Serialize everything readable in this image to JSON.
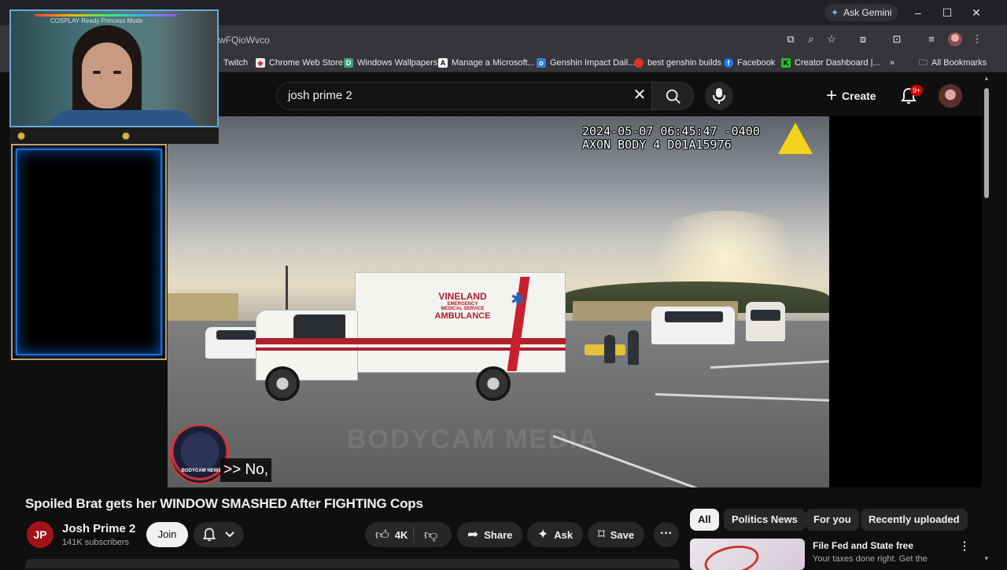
{
  "browser": {
    "gemini_label": "Ask Gemini",
    "url_fragment": "wFQioWvco",
    "bookmarks": [
      {
        "label": "Twitch"
      },
      {
        "label": "Chrome Web Store"
      },
      {
        "label": "Windows Wallpapers"
      },
      {
        "label": "Manage a Microsoft..."
      },
      {
        "label": "Genshin Impact Dail..."
      },
      {
        "label": "best genshin builds"
      },
      {
        "label": "Facebook"
      },
      {
        "label": "Creator Dashboard |..."
      }
    ],
    "bookmarks_overflow": "»",
    "all_bookmarks": "All Bookmarks",
    "window_controls": {
      "minimize": "–",
      "maximize": "☐",
      "close": "✕"
    }
  },
  "youtube_header": {
    "search_query": "josh prime 2",
    "create_label": "Create",
    "notification_badge": "9+"
  },
  "video": {
    "cam_timestamp": "2024-05-07 06:45:47 -0400",
    "cam_device": "AXON BODY 4 D01A15976",
    "caption": ">> No,",
    "ambulance_text": {
      "line1": "VINELAND",
      "line2": "EMERGENCY",
      "line3": "MEDICAL SERVICE",
      "line4": "AMBULANCE"
    },
    "watermark": "BODYCAM MEDIA",
    "badge_text": "BODYCAM NEWS"
  },
  "video_info": {
    "title": "Spoiled Brat gets her WINDOW SMASHED After FIGHTING Cops",
    "channel_initials": "JP",
    "channel_name": "Josh Prime 2",
    "subscribers": "141K subscribers",
    "join_label": "Join",
    "like_count": "4K",
    "share_label": "Share",
    "ask_label": "Ask",
    "save_label": "Save"
  },
  "sidebar": {
    "chips": [
      {
        "label": "All",
        "active": true
      },
      {
        "label": "Politics News",
        "active": false
      },
      {
        "label": "For you",
        "active": false
      },
      {
        "label": "Recently uploaded",
        "active": false
      }
    ],
    "recommendation": {
      "title": "File Fed and State free",
      "subtitle": "Your taxes done right. Get the"
    }
  },
  "webcam": {
    "top_text": "COSPLAY Ready Princess Mode"
  },
  "colors": {
    "background": "#0f0f0f",
    "pill": "#272727",
    "accent_red": "#cc0000",
    "ambulance_red": "#b0202a",
    "webcam_border": "#6aa9d6",
    "frame_gold": "#c9a46a",
    "frame_blue": "#1e6fd1"
  },
  "icons": [
    "gemini-star-icon",
    "minimize-icon",
    "maximize-icon",
    "close-icon",
    "screenshot-icon",
    "zoom-icon",
    "bookmark-star-icon",
    "extensions-icon",
    "tab-search-icon",
    "reading-list-icon",
    "profile-icon",
    "menu-dots-icon",
    "folder-icon",
    "clear-icon",
    "search-icon",
    "mic-icon",
    "plus-icon",
    "bell-icon",
    "thumbs-up-icon",
    "thumbs-down-icon",
    "share-icon",
    "sparkle-icon",
    "save-icon",
    "more-icon",
    "kebab-icon"
  ]
}
